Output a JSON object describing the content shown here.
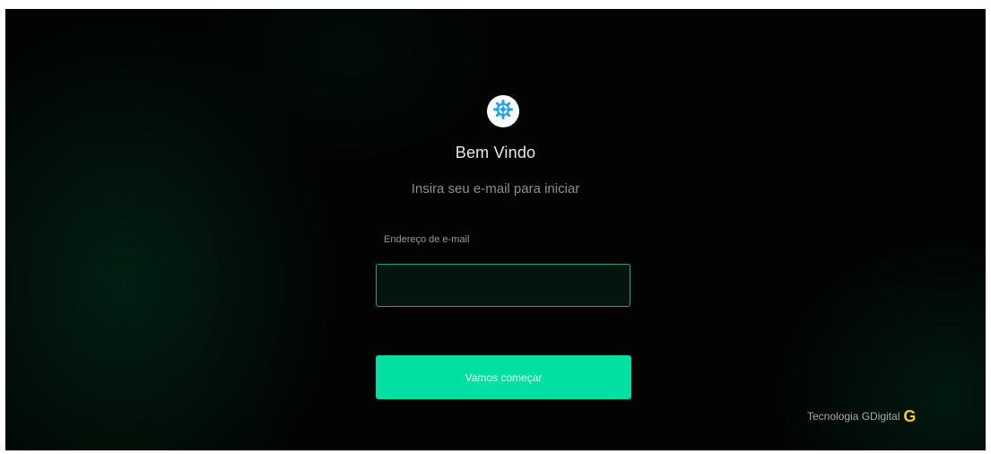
{
  "brand": {
    "logo_icon": "gear-icon",
    "logo_background": "#ffffff",
    "logo_color": "#1fa3e8"
  },
  "welcome": {
    "title": "Bem Vindo",
    "subtitle": "Insira seu e-mail para iniciar"
  },
  "form": {
    "email_label": "Endereço de e-mail",
    "email_value": "",
    "submit_label": "Vamos começar"
  },
  "footer": {
    "text": "Tecnologia GDigital",
    "brand_icon": "g-logo-icon",
    "brand_glyph": "G"
  },
  "colors": {
    "accent": "#02dfa3",
    "input_border": "#16a86e",
    "background": "#020302",
    "brand_yellow": "#f7c72c"
  }
}
